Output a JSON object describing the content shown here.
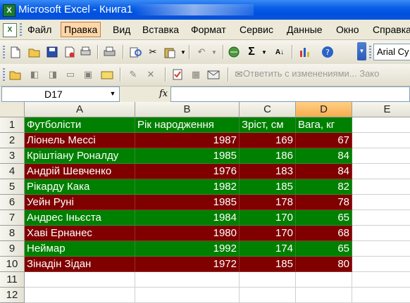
{
  "window": {
    "title": "Microsoft Excel - Книга1"
  },
  "menu": {
    "items": [
      "Файл",
      "Правка",
      "Вид",
      "Вставка",
      "Формат",
      "Сервис",
      "Данные",
      "Окно",
      "Справка"
    ],
    "active": "Правка"
  },
  "toolbar": {
    "font_name": "Arial Cy",
    "review_text": "Ответить с изменениями... Зако"
  },
  "formula_bar": {
    "name_box": "D17",
    "fx": "fx",
    "formula": ""
  },
  "colors": {
    "header_bg": "#008000",
    "odd_row_bg": "#800000",
    "even_row_bg": "#008000",
    "text": "#ffffff",
    "selected_column_header": "#f8b35b"
  },
  "grid": {
    "columns": [
      "A",
      "B",
      "C",
      "D",
      "E"
    ],
    "selected_column": "D",
    "row_numbers": [
      "1",
      "2",
      "3",
      "4",
      "5",
      "6",
      "7",
      "8",
      "9",
      "10",
      "11",
      "12"
    ],
    "headers": [
      "Футболісти",
      "Рік народження",
      "Зріст, см",
      "Вага, кг"
    ],
    "rows": [
      [
        "Ліонель Мессі",
        "1987",
        "169",
        "67"
      ],
      [
        "Кріштіану Роналду",
        "1985",
        "186",
        "84"
      ],
      [
        "Андрій Шевченко",
        "1976",
        "183",
        "84"
      ],
      [
        "Рікарду Кака",
        "1982",
        "185",
        "82"
      ],
      [
        "Уейн Руні",
        "1985",
        "178",
        "78"
      ],
      [
        "Андрес Іньєста",
        "1984",
        "170",
        "65"
      ],
      [
        "Хаві Ернанес",
        "1980",
        "170",
        "68"
      ],
      [
        "Неймар",
        "1992",
        "174",
        "65"
      ],
      [
        "Зінадін Зідан",
        "1972",
        "185",
        "80"
      ]
    ]
  }
}
